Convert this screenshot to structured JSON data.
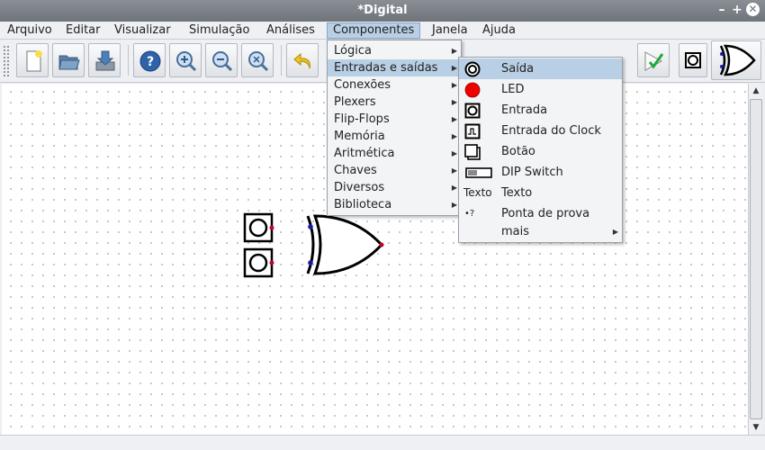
{
  "window": {
    "title": "*Digital"
  },
  "menubar": [
    "Arquivo",
    "Editar",
    "Visualizar",
    "Simulação",
    "Análises",
    "Componentes",
    "Janela",
    "Ajuda"
  ],
  "components_menu": {
    "items": [
      "Lógica",
      "Entradas e saídas",
      "Conexões",
      "Plexers",
      "Flip-Flops",
      "Memória",
      "Aritmética",
      "Chaves",
      "Diversos",
      "Biblioteca"
    ],
    "selected": "Entradas e saídas"
  },
  "io_submenu": {
    "items": [
      {
        "label": "Saída",
        "icon": "output-icon"
      },
      {
        "label": "LED",
        "icon": "led-icon"
      },
      {
        "label": "Entrada",
        "icon": "input-icon"
      },
      {
        "label": "Entrada do Clock",
        "icon": "clock-input-icon"
      },
      {
        "label": "Botão",
        "icon": "button-icon"
      },
      {
        "label": "DIP Switch",
        "icon": "dip-switch-icon"
      },
      {
        "label": "Texto",
        "icon": "text-icon",
        "icon_text": "Texto"
      },
      {
        "label": "Ponta de prova",
        "icon": "probe-icon",
        "icon_text": "•?"
      },
      {
        "label": "mais",
        "icon": ""
      }
    ],
    "selected": "Saída"
  },
  "toolbar": {
    "buttons": [
      "new-file",
      "open-file",
      "save-file",
      "help",
      "zoom-in",
      "zoom-out",
      "zoom-fit",
      "undo",
      "start-simulation",
      "input-component",
      "xor-gate"
    ]
  },
  "colors": {
    "accent": "#b8cfe5",
    "led": "#ee0000",
    "pin_in": "#1a1aa8",
    "pin_out": "#c8002a",
    "check": "#1eaa3a"
  }
}
